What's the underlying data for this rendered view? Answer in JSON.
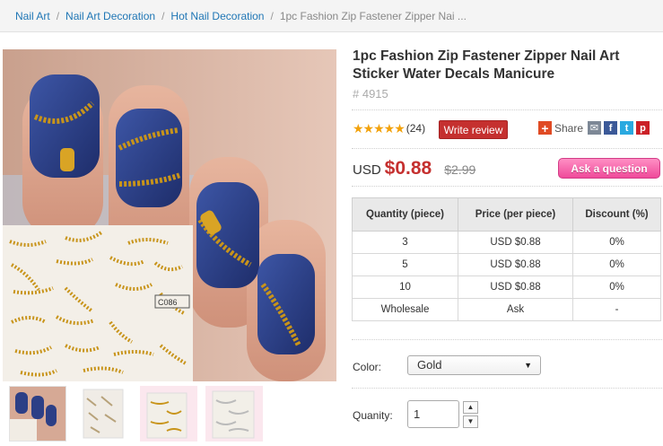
{
  "breadcrumb": {
    "items": [
      "Nail Art",
      "Nail Art Decoration",
      "Hot Nail Decoration"
    ],
    "separator": "/",
    "current": "1pc Fashion Zip Fastener Zipper Nai ..."
  },
  "product": {
    "title": "1pc Fashion Zip Fastener Zipper Nail Art Sticker Water Decals Manicure",
    "sku": "# 4915",
    "rating_stars": 5,
    "review_count": "(24)",
    "write_review_label": "Write review",
    "share_label": "Share",
    "currency": "USD",
    "price": "$0.88",
    "old_price": "$2.99",
    "ask_label": "Ask a question",
    "sticker_code": "C086"
  },
  "price_table": {
    "headers": [
      "Quantity (piece)",
      "Price (per piece)",
      "Discount (%)"
    ],
    "rows": [
      [
        "3",
        "USD $0.88",
        "0%"
      ],
      [
        "5",
        "USD $0.88",
        "0%"
      ],
      [
        "10",
        "USD $0.88",
        "0%"
      ],
      [
        "Wholesale",
        "Ask",
        "-"
      ]
    ]
  },
  "options": {
    "color_label": "Color:",
    "color_value": "Gold",
    "quantity_label": "Quanity:",
    "quantity_value": "1"
  },
  "colors": {
    "link": "#1f76b5",
    "price_red": "#c5302f",
    "ask_pink": "#ef4a9a",
    "nail_blue": "#2c3f86",
    "zipper_gold": "#c8941a",
    "star": "#f2a20c"
  },
  "icons": [
    "plus-share-icon",
    "email-icon",
    "facebook-icon",
    "twitter-icon",
    "pinterest-icon",
    "chevron-down-icon",
    "caret-up-icon",
    "caret-down-icon"
  ]
}
